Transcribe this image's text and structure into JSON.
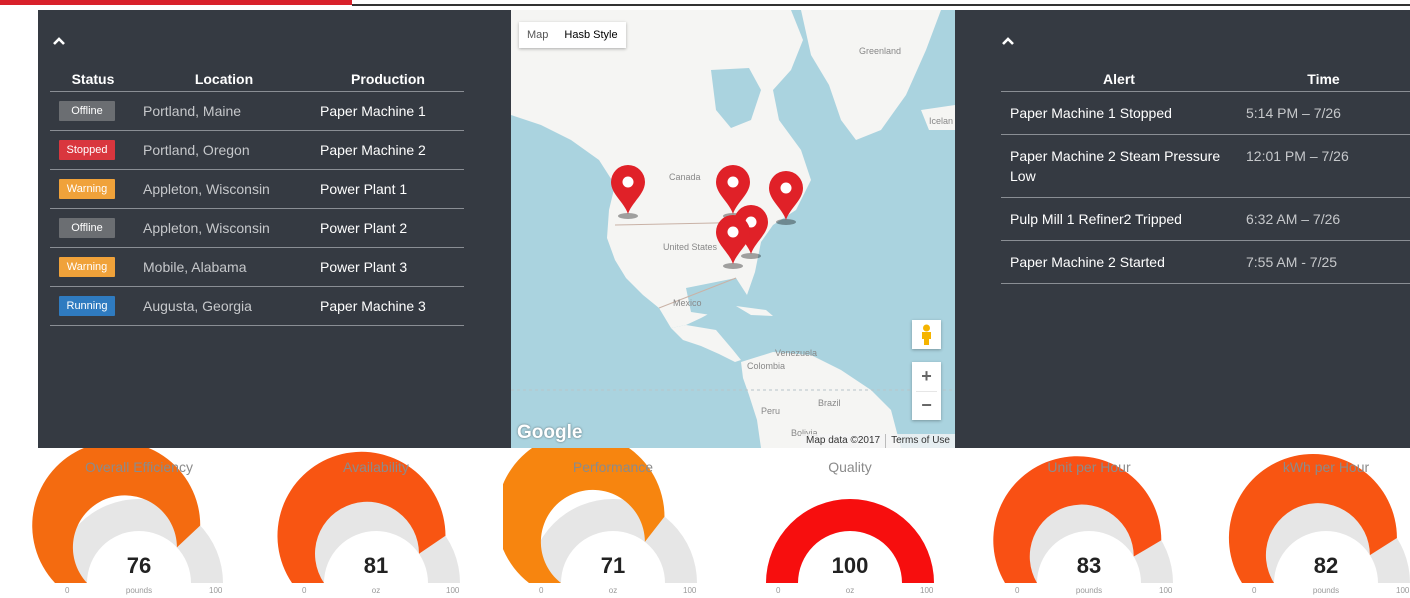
{
  "status_panel": {
    "headers": {
      "status": "Status",
      "location": "Location",
      "production": "Production"
    },
    "rows": [
      {
        "status": "Offline",
        "status_color": "#6b6e72",
        "location": "Portland, Maine",
        "production": "Paper Machine 1"
      },
      {
        "status": "Stopped",
        "status_color": "#d9363e",
        "location": "Portland, Oregon",
        "production": "Paper Machine 2"
      },
      {
        "status": "Warning",
        "status_color": "#f0a23a",
        "location": "Appleton, Wisconsin",
        "production": "Power Plant 1"
      },
      {
        "status": "Offline",
        "status_color": "#6b6e72",
        "location": "Appleton, Wisconsin",
        "production": "Power Plant 2"
      },
      {
        "status": "Warning",
        "status_color": "#f0a23a",
        "location": "Mobile, Alabama",
        "production": "Power Plant 3"
      },
      {
        "status": "Running",
        "status_color": "#2f7bc0",
        "location": "Augusta, Georgia",
        "production": "Paper Machine 3"
      }
    ]
  },
  "map": {
    "type_options": [
      "Map",
      "Hasb Style"
    ],
    "labels": {
      "greenland": "Greenland",
      "iceland": "Icelan",
      "canada": "Canada",
      "united_states": "United States",
      "mexico": "Mexico",
      "venezuela": "Venezuela",
      "colombia": "Colombia",
      "peru": "Peru",
      "brazil": "Brazil",
      "bolivia": "Bolivia"
    },
    "logo": "Google",
    "attribution": "Map data ©2017",
    "terms": "Terms of Use",
    "zoom_in": "+",
    "zoom_out": "−",
    "marker_color": "#e02128"
  },
  "alert_panel": {
    "headers": {
      "alert": "Alert",
      "time": "Time"
    },
    "rows": [
      {
        "alert": "Paper Machine 1 Stopped",
        "time": "5:14 PM – 7/26"
      },
      {
        "alert": "Paper Machine 2 Steam Pressure Low",
        "time": "12:01 PM – 7/26"
      },
      {
        "alert": "Pulp Mill 1 Refiner2 Tripped",
        "time": "6:32 AM – 7/26"
      },
      {
        "alert": "Paper Machine 2 Started",
        "time": "7:55 AM - 7/25"
      }
    ]
  },
  "gauges": [
    {
      "title": "Overall Efficiency",
      "value": "76",
      "unit": "pounds",
      "min": "0",
      "max": "100",
      "fraction": 0.76,
      "color": "#f46b10"
    },
    {
      "title": "Availability",
      "value": "81",
      "unit": "oz",
      "min": "0",
      "max": "100",
      "fraction": 0.81,
      "color": "#f85512"
    },
    {
      "title": "Performance",
      "value": "71",
      "unit": "oz",
      "min": "0",
      "max": "100",
      "fraction": 0.71,
      "color": "#f7850f"
    },
    {
      "title": "Quality",
      "value": "100",
      "unit": "oz",
      "min": "0",
      "max": "100",
      "fraction": 1.0,
      "color": "#f70e0e"
    },
    {
      "title": "Unit per Hour",
      "value": "83",
      "unit": "pounds",
      "min": "0",
      "max": "100",
      "fraction": 0.83,
      "color": "#f95014"
    },
    {
      "title": "kWh per Hour",
      "value": "82",
      "unit": "pounds",
      "min": "0",
      "max": "100",
      "fraction": 0.82,
      "color": "#f85512"
    }
  ],
  "colors": {
    "panel_bg": "#353a42",
    "gauge_track": "#e6e6e6",
    "brand_red": "#d8212b"
  }
}
